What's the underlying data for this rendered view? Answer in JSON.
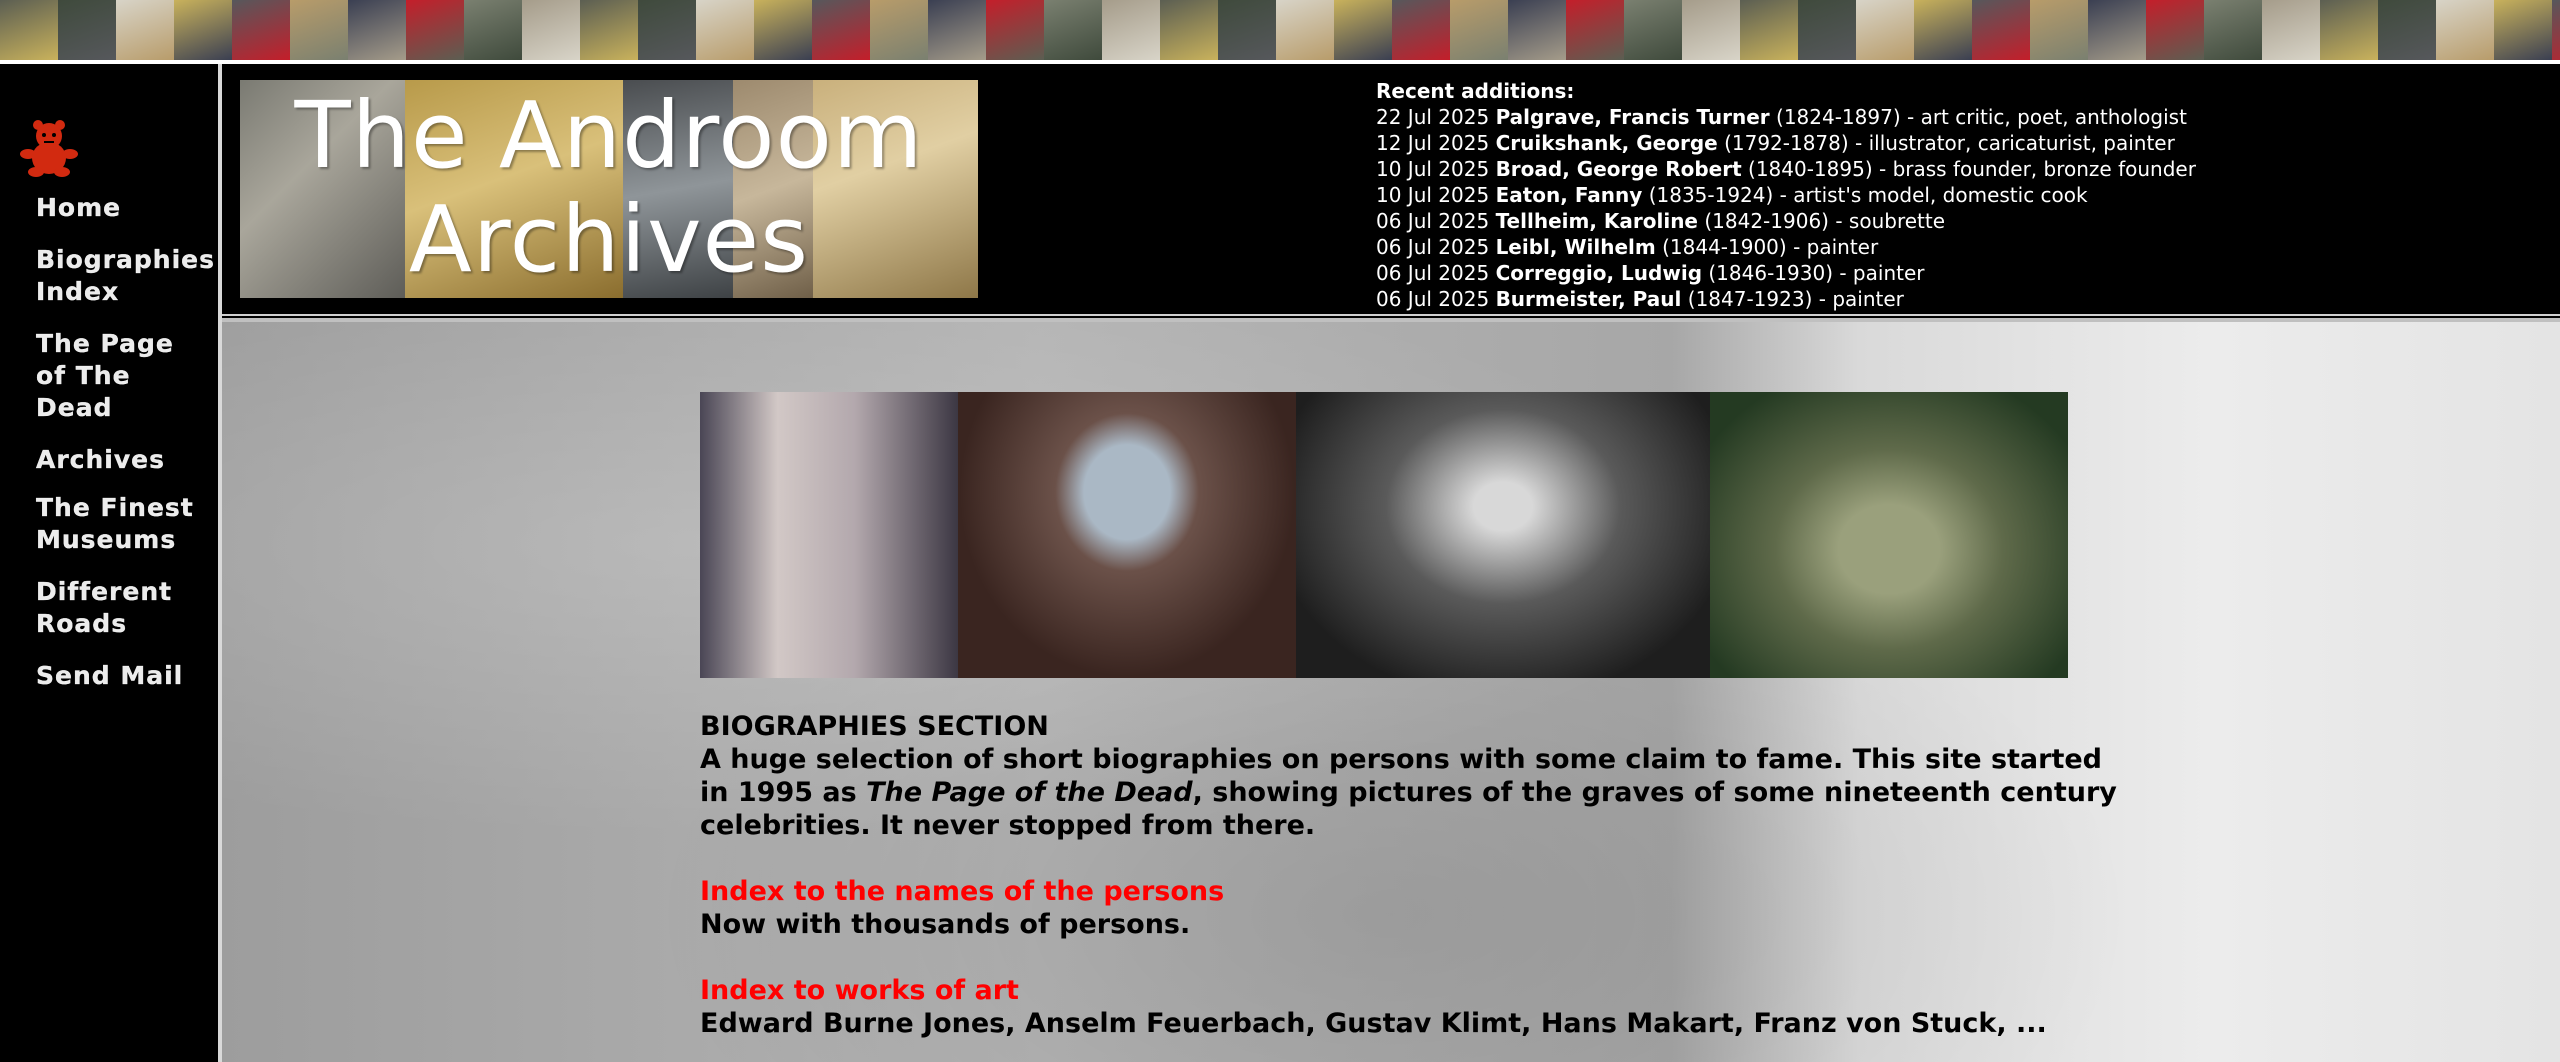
{
  "colors": {
    "background": "#000000",
    "nav_text": "#ececec",
    "link_red": "#ff0000",
    "content_text": "#000000"
  },
  "top_strip": {
    "tile_colors": [
      "#5b5e52",
      "#3f4a3c",
      "#d8d4c8",
      "#c9b25c",
      "#56585c",
      "#b89c6a",
      "#3a3f52",
      "#c41e2a",
      "#7a8070",
      "#a59c8a"
    ]
  },
  "sidebar": {
    "logo_icon": "red-teddy-figure-icon",
    "items": [
      {
        "label": "Home"
      },
      {
        "label": "Biographies Index"
      },
      {
        "label": "The Page of The Dead"
      },
      {
        "label": "Archives"
      },
      {
        "label": "The Finest Museums"
      },
      {
        "label": "Different Roads"
      },
      {
        "label": "Send Mail"
      }
    ]
  },
  "header": {
    "banner_title_line1": "The Androom",
    "banner_title_line2": "Archives",
    "recent_heading": "Recent additions:",
    "recent": [
      {
        "date": "22 Jul 2025",
        "name": "Palgrave, Francis Turner",
        "years": "(1824-1897)",
        "desc": "- art critic, poet, anthologist"
      },
      {
        "date": "12 Jul 2025",
        "name": "Cruikshank, George",
        "years": "(1792-1878)",
        "desc": "- illustrator, caricaturist, painter"
      },
      {
        "date": "10 Jul 2025",
        "name": "Broad, George Robert",
        "years": "(1840-1895)",
        "desc": "- brass founder, bronze founder"
      },
      {
        "date": "10 Jul 2025",
        "name": "Eaton, Fanny",
        "years": "(1835-1924)",
        "desc": "- artist's model, domestic cook"
      },
      {
        "date": "06 Jul 2025",
        "name": "Tellheim, Karoline",
        "years": "(1842-1906)",
        "desc": "- soubrette"
      },
      {
        "date": "06 Jul 2025",
        "name": "Leibl, Wilhelm",
        "years": "(1844-1900)",
        "desc": "- painter"
      },
      {
        "date": "06 Jul 2025",
        "name": "Correggio, Ludwig",
        "years": "(1846-1930)",
        "desc": "- painter"
      },
      {
        "date": "06 Jul 2025",
        "name": "Burmeister, Paul",
        "years": "(1847-1923)",
        "desc": "- painter"
      }
    ]
  },
  "main": {
    "section_title": "BIOGRAPHIES SECTION",
    "intro_before": "A huge selection of short biographies on persons with some claim to fame. This site started in 1995 as ",
    "intro_italic": "The Page of the Dead",
    "intro_after": ", showing pictures of the graves of some nineteenth century celebrities. It never stopped from there.",
    "link1": "Index to the names of the persons",
    "link1_sub": "Now with thousands of persons.",
    "link2": "Index to works of art",
    "link2_sub": "Edward Burne Jones, Anselm Feuerbach, Gustav Klimt, Hans Makart, Franz von Stuck, ..."
  }
}
